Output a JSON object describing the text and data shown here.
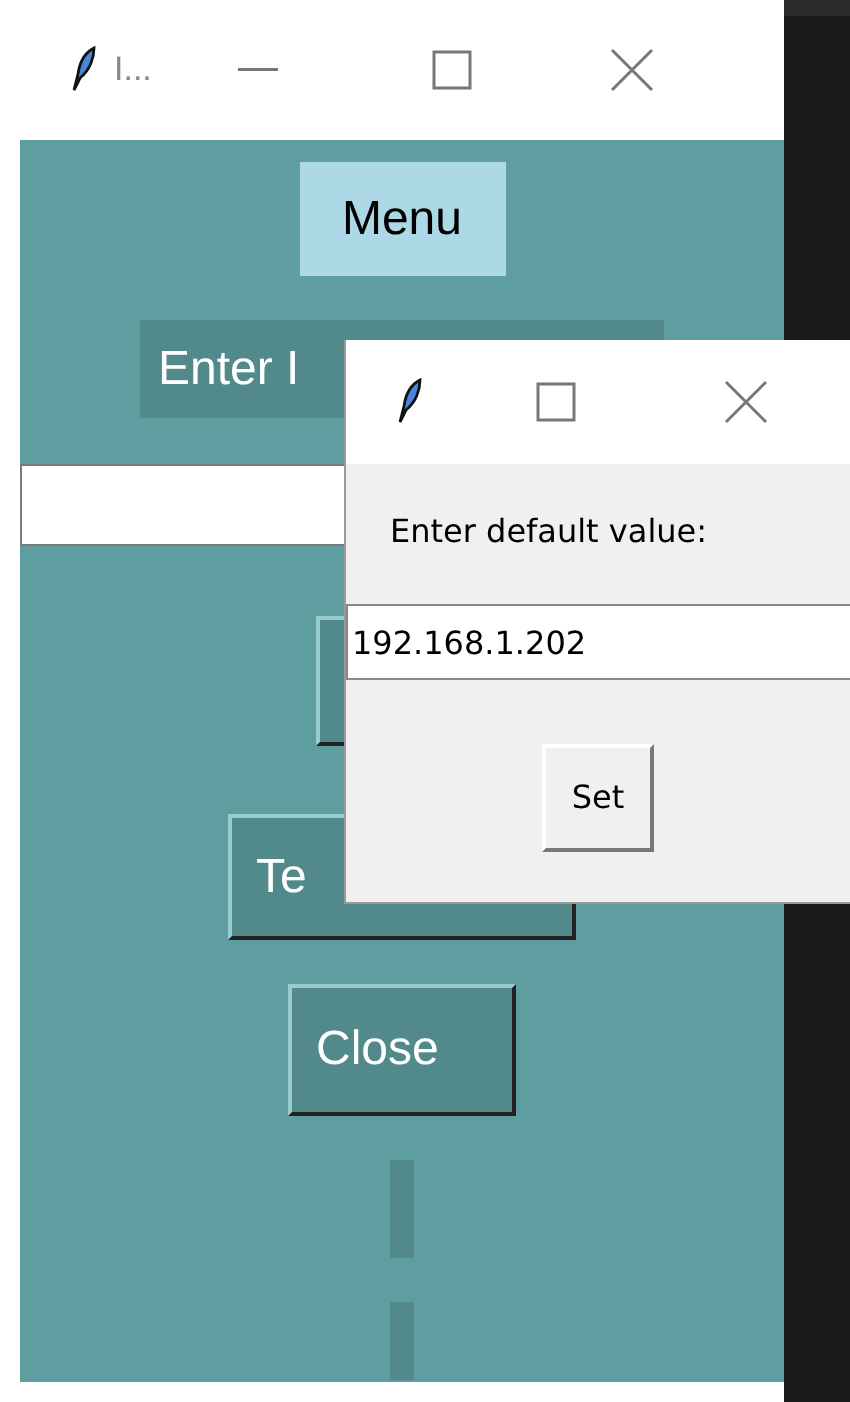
{
  "main_window": {
    "title": "I...",
    "menu_label": "Menu",
    "prompt_label": "Enter I",
    "buttons": [
      {
        "label": "Te"
      },
      {
        "label": "Close"
      }
    ]
  },
  "dialog": {
    "label": "Enter default value:",
    "value": "192.168.1.202",
    "button": "Set"
  }
}
